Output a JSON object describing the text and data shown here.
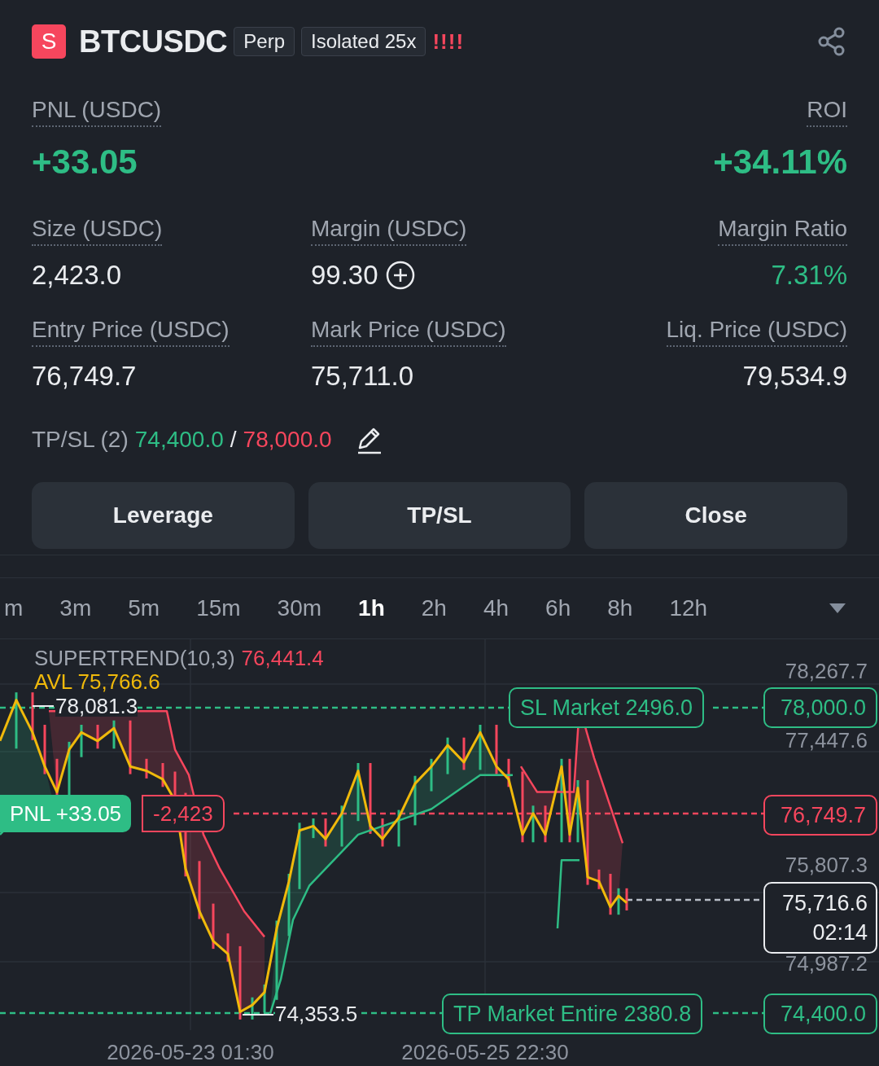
{
  "header": {
    "symbol_icon": "S",
    "symbol": "BTCUSDC",
    "badges": [
      "Perp",
      "Isolated 25x"
    ],
    "warning": "!!!!"
  },
  "pnl": {
    "label": "PNL (USDC)",
    "value": "+33.05"
  },
  "roi": {
    "label": "ROI",
    "value": "+34.11%"
  },
  "stats": [
    {
      "label": "Size (USDC)",
      "value": "2,423.0",
      "positive": false
    },
    {
      "label": "Margin (USDC)",
      "value": "99.30",
      "positive": false,
      "add_button": true
    },
    {
      "label": "Margin Ratio",
      "value": "7.31%",
      "positive": true
    },
    {
      "label": "Entry Price (USDC)",
      "value": "76,749.7",
      "positive": false
    },
    {
      "label": "Mark Price (USDC)",
      "value": "75,711.0",
      "positive": false
    },
    {
      "label": "Liq. Price (USDC)",
      "value": "79,534.9",
      "positive": false
    }
  ],
  "tpsl": {
    "label": "TP/SL (2)",
    "take_profit": "74,400.0",
    "separator": "/",
    "stop_loss": "78,000.0"
  },
  "buttons": [
    "Leverage",
    "TP/SL",
    "Close"
  ],
  "timeframes": [
    {
      "label": "m",
      "selected": false
    },
    {
      "label": "3m",
      "selected": false
    },
    {
      "label": "5m",
      "selected": false
    },
    {
      "label": "15m",
      "selected": false
    },
    {
      "label": "30m",
      "selected": false
    },
    {
      "label": "1h",
      "selected": true
    },
    {
      "label": "2h",
      "selected": false
    },
    {
      "label": "4h",
      "selected": false
    },
    {
      "label": "6h",
      "selected": false
    },
    {
      "label": "8h",
      "selected": false
    },
    {
      "label": "12h",
      "selected": false
    }
  ],
  "chart": {
    "indicator": {
      "name": "SUPERTREND(10,3)",
      "value": "76,441.4"
    },
    "avl": "AVL 75,766.6",
    "high_marker": "78,081.3",
    "low_marker": "74,353.5",
    "y_axis_labels": [
      "78,267.7",
      "77,447.6",
      "75,807.3",
      "74,987.2"
    ],
    "orders": [
      {
        "kind": "sl",
        "label": "SL Market 2496.0",
        "price": "78,000.0"
      },
      {
        "kind": "tp",
        "label": "TP Market Entire 2380.8",
        "price": "74,400.0"
      }
    ],
    "position": {
      "pnl": "PNL +33.05",
      "size": "-2,423",
      "price": "76,749.7"
    },
    "last_price": {
      "price": "75,716.6",
      "countdown": "02:14"
    },
    "x_axis_labels": [
      "2026-05-23 01:30",
      "2026-05-25 22:30"
    ]
  }
}
